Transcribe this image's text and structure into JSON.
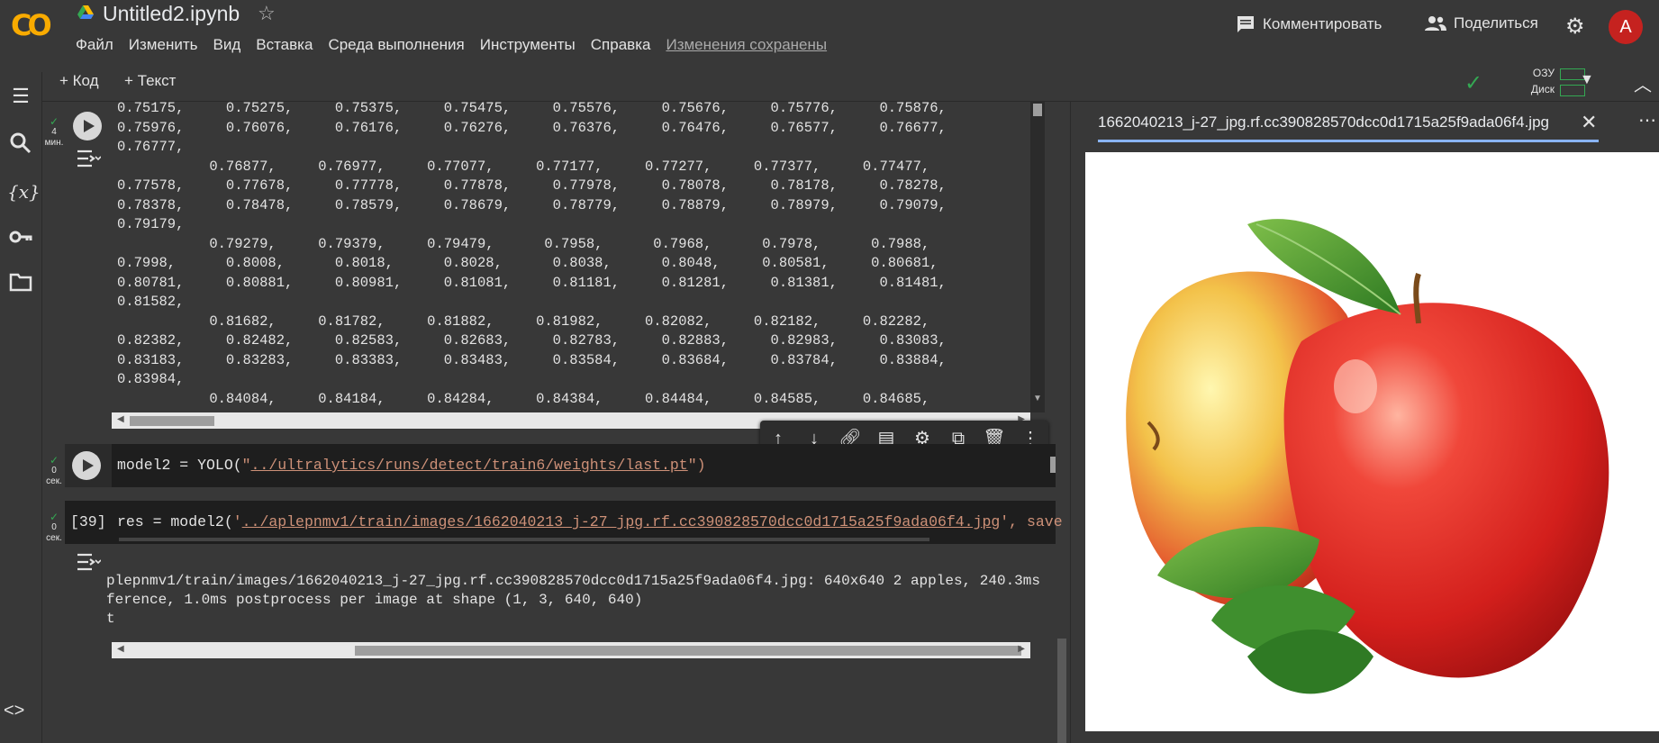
{
  "app": {
    "logo_text": "CO",
    "title": "Untitled2.ipynb",
    "star_icon": "star-icon"
  },
  "menu": [
    "Файл",
    "Изменить",
    "Вид",
    "Вставка",
    "Среда выполнения",
    "Инструменты",
    "Справка"
  ],
  "saved_status": "Изменения сохранены",
  "header_actions": {
    "comment": "Комментировать",
    "share": "Поделиться",
    "avatar": "A"
  },
  "toolbar": {
    "add_code": "+ Код",
    "add_text": "+ Текст",
    "ram_label": "ОЗУ",
    "disk_label": "Диск"
  },
  "cells": {
    "cell1": {
      "status_time": "4",
      "status_unit": "мин.",
      "output_lines": [
        "0.75175,     0.75275,     0.75375,     0.75475,     0.75576,     0.75676,     0.75776,     0.75876,",
        "0.75976,     0.76076,     0.76176,     0.76276,     0.76376,     0.76476,     0.76577,     0.76677,",
        "0.76777,",
        "           0.76877,     0.76977,     0.77077,     0.77177,     0.77277,     0.77377,     0.77477,",
        "0.77578,     0.77678,     0.77778,     0.77878,     0.77978,     0.78078,     0.78178,     0.78278,",
        "0.78378,     0.78478,     0.78579,     0.78679,     0.78779,     0.78879,     0.78979,     0.79079,",
        "0.79179,",
        "           0.79279,     0.79379,     0.79479,      0.7958,      0.7968,      0.7978,      0.7988,",
        "0.7998,      0.8008,      0.8018,      0.8028,      0.8038,      0.8048,     0.80581,     0.80681,",
        "0.80781,     0.80881,     0.80981,     0.81081,     0.81181,     0.81281,     0.81381,     0.81481,",
        "0.81582,",
        "           0.81682,     0.81782,     0.81882,     0.81982,     0.82082,     0.82182,     0.82282,",
        "0.82382,     0.82482,     0.82583,     0.82683,     0.82783,     0.82883,     0.82983,     0.83083,",
        "0.83183,     0.83283,     0.83383,     0.83483,     0.83584,     0.83684,     0.83784,     0.83884,",
        "0.83984,",
        "           0.84084,     0.84184,     0.84284,     0.84384,     0.84484,     0.84585,     0.84685,"
      ]
    },
    "cell2": {
      "status_time": "0",
      "status_unit": "сек.",
      "code_prefix": "model2 = YOLO(",
      "code_quote_open": "\"",
      "code_path": "../ultralytics/runs/detect/train6/weights/last.pt",
      "code_quote_close": "\")"
    },
    "cell3": {
      "status_time": "0",
      "status_unit": "сек.",
      "exec_count": "[39]",
      "code_prefix": "res = model2(",
      "code_quote_open": "'",
      "code_path": "../aplepnmv1/train/images/1662040213_j-27_jpg.rf.cc390828570dcc0d1715a25f9ada06f4.jpg",
      "code_suffix": "', save",
      "output_lines": [
        "plepnmv1/train/images/1662040213_j-27_jpg.rf.cc390828570dcc0d1715a25f9ada06f4.jpg: 640x640 2 apples, 240.3ms",
        "ference, 1.0ms postprocess per image at shape (1, 3, 640, 640)",
        "t"
      ]
    }
  },
  "cell_toolbar_icons": [
    "arrow-up-icon",
    "arrow-down-icon",
    "link-icon",
    "comment-icon",
    "gear-icon",
    "mirror-icon",
    "trash-icon",
    "more-icon"
  ],
  "viewer": {
    "tab_label": "1662040213_j-27_jpg.rf.cc390828570dcc0d1715a25f9ada06f4.jpg",
    "image_subject": "apples"
  },
  "colors": {
    "background": "#383838",
    "code_background": "#1e1e1e",
    "string": "#ce9178",
    "accent_tab": "#8ab4f8",
    "check": "#34a853",
    "avatar": "#c5221f"
  }
}
